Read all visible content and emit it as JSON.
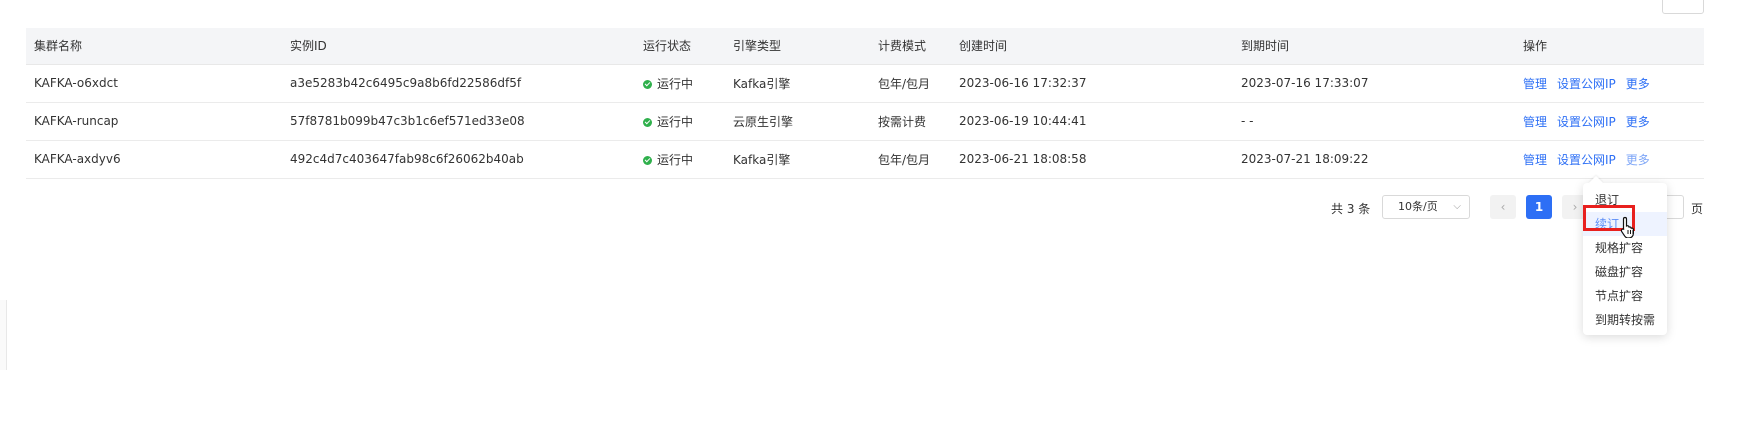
{
  "table": {
    "headers": [
      "集群名称",
      "实例ID",
      "运行状态",
      "引擎类型",
      "计费模式",
      "创建时间",
      "到期时间",
      "操作"
    ],
    "rows": [
      {
        "name": "KAFKA-o6xdct",
        "id": "a3e5283b42c6495c9a8b6fd22586df5f",
        "status": "运行中",
        "engine": "Kafka引擎",
        "billing": "包年/包月",
        "created": "2023-06-16 17:32:37",
        "expires": "2023-07-16 17:33:07",
        "ops": [
          "管理",
          "设置公网IP",
          "更多"
        ]
      },
      {
        "name": "KAFKA-runcap",
        "id": "57f8781b099b47c3b1c6ef571ed33e08",
        "status": "运行中",
        "engine": "云原生引擎",
        "billing": "按需计费",
        "created": "2023-06-19 10:44:41",
        "expires": "- -",
        "ops": [
          "管理",
          "设置公网IP",
          "更多"
        ]
      },
      {
        "name": "KAFKA-axdyv6",
        "id": "492c4d7c403647fab98c6f26062b40ab",
        "status": "运行中",
        "engine": "Kafka引擎",
        "billing": "包年/包月",
        "created": "2023-06-21 18:08:58",
        "expires": "2023-07-21 18:09:22",
        "ops": [
          "管理",
          "设置公网IP",
          "更多"
        ]
      }
    ]
  },
  "pagination": {
    "total_label": "共 3 条",
    "page_size": "10条/页",
    "current_page": "1",
    "prev_icon": "‹",
    "next_icon": "›",
    "page_unit": "页"
  },
  "dropdown": {
    "items": [
      "退订",
      "续订",
      "规格扩容",
      "磁盘扩容",
      "节点扩容",
      "到期转按需"
    ],
    "hovered_index": 1
  },
  "colors": {
    "link": "#2d6ff5",
    "status_green": "#2fb04c",
    "highlight_red": "#e8201e"
  }
}
